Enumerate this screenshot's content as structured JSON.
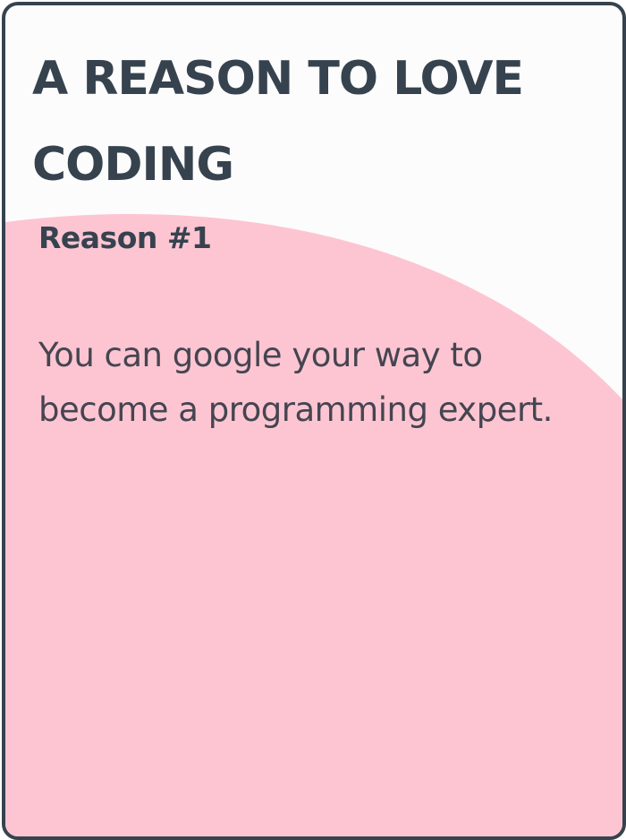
{
  "card": {
    "title": "A REASON TO LOVE CODING",
    "subtitle": "Reason #1",
    "body": "You can google your way to become a programming expert."
  },
  "colors": {
    "border": "#36434f",
    "text": "#36434f",
    "body_text": "#454551",
    "card_background": "#fdfcfd",
    "accent_blob": "#fdc5d2"
  }
}
